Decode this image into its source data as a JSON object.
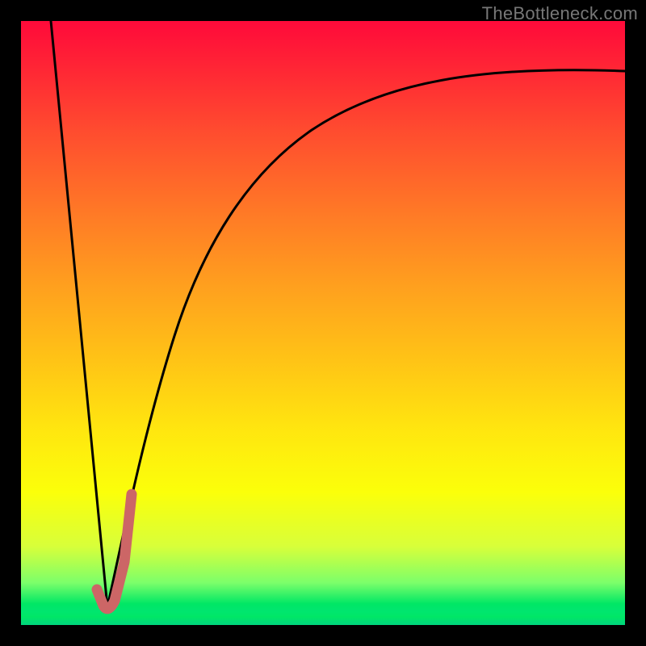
{
  "watermark": "TheBottleneck.com",
  "colors": {
    "background": "#000000",
    "curve_stroke": "#000000",
    "accent_stroke": "#cc6666",
    "gradient_top": "#ff0a3a",
    "gradient_mid": "#ffe70f",
    "gradient_bottom": "#00e283"
  },
  "chart_data": {
    "type": "line",
    "title": "",
    "xlabel": "",
    "ylabel": "",
    "x_range": [
      0,
      100
    ],
    "y_range": [
      0,
      100
    ],
    "series": [
      {
        "name": "left-descent",
        "x": [
          5,
          14.3
        ],
        "y": [
          100,
          3
        ]
      },
      {
        "name": "right-growth",
        "x": [
          14.3,
          18,
          22,
          26,
          32,
          40,
          50,
          62,
          76,
          90,
          100
        ],
        "y": [
          3,
          20,
          36,
          48,
          60,
          70,
          78,
          84,
          88,
          90.5,
          91.5
        ]
      },
      {
        "name": "accent-hook",
        "x": [
          12.5,
          13.6,
          14.3,
          15.4,
          16.7,
          18.2
        ],
        "y": [
          6,
          3.2,
          3,
          5,
          12,
          22
        ]
      }
    ],
    "notes": "Values estimated from pixel positions; x and y expressed as 0-100 percent of plot area. The accent-hook series is drawn thicker in a muted red over the valley."
  }
}
